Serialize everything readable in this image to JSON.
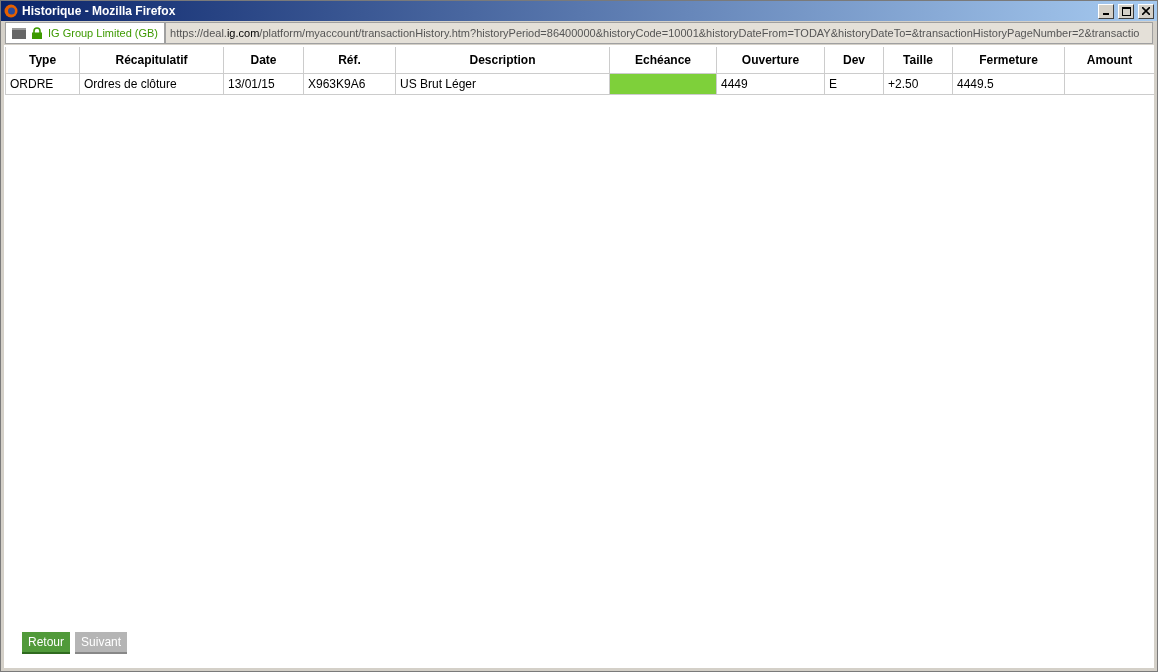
{
  "window": {
    "title": "Historique - Mozilla Firefox"
  },
  "address_bar": {
    "identity": "IG Group Limited (GB)",
    "url_prefix": "https://deal.",
    "url_domain": "ig.com",
    "url_rest": "/platform/myaccount/transactionHistory.htm?historyPeriod=86400000&historyCode=10001&historyDateFrom=TODAY&historyDateTo=&transactionHistoryPageNumber=2&transactio"
  },
  "table": {
    "columns": [
      "Type",
      "Récapitulatif",
      "Date",
      "Réf.",
      "Description",
      "Echéance",
      "Ouverture",
      "Dev",
      "Taille",
      "Fermeture",
      "Amount"
    ],
    "rows": [
      {
        "cells": [
          {
            "text": "ORDRE",
            "highlighted": false
          },
          {
            "text": "Ordres de clôture",
            "highlighted": false
          },
          {
            "text": "13/01/15",
            "highlighted": false
          },
          {
            "text": "X963K9A6",
            "highlighted": false
          },
          {
            "text": "US Brut Léger",
            "highlighted": false
          },
          {
            "highlighted": true
          },
          {
            "text": "4449",
            "highlighted": false
          },
          {
            "text": "E",
            "highlighted": false
          },
          {
            "text": "+2.50",
            "highlighted": false
          },
          {
            "text": "4449.5",
            "highlighted": false
          },
          {
            "highlighted": false
          }
        ]
      }
    ]
  },
  "buttons": [
    {
      "label": "Retour",
      "disabled": false
    },
    {
      "label": "Suivant",
      "disabled": true
    }
  ]
}
